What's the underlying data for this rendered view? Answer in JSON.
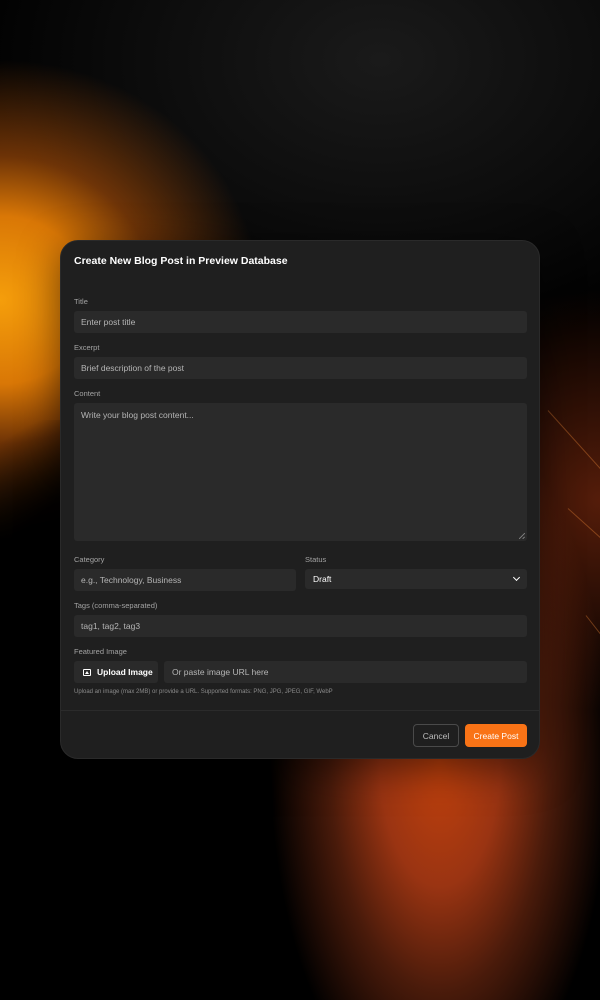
{
  "modal": {
    "title": "Create New Blog Post in Preview Database"
  },
  "fields": {
    "title": {
      "label": "Title",
      "placeholder": "Enter post title"
    },
    "excerpt": {
      "label": "Excerpt",
      "placeholder": "Brief description of the post"
    },
    "content": {
      "label": "Content",
      "placeholder": "Write your blog post content..."
    },
    "category": {
      "label": "Category",
      "placeholder": "e.g., Technology, Business"
    },
    "status": {
      "label": "Status",
      "value": "Draft",
      "options": [
        "Draft"
      ]
    },
    "tags": {
      "label": "Tags (comma-separated)",
      "placeholder": "tag1, tag2, tag3"
    },
    "featured_image": {
      "label": "Featured Image",
      "upload_label": "Upload Image",
      "url_placeholder": "Or paste image URL here",
      "hint": "Upload an image (max 2MB) or provide a URL. Supported formats: PNG, JPG, JPEG, GIF, WebP"
    }
  },
  "actions": {
    "cancel": "Cancel",
    "create": "Create Post"
  },
  "colors": {
    "accent": "#f97316",
    "modal_bg": "#1f1f1f",
    "field_bg": "#2a2a2a"
  }
}
